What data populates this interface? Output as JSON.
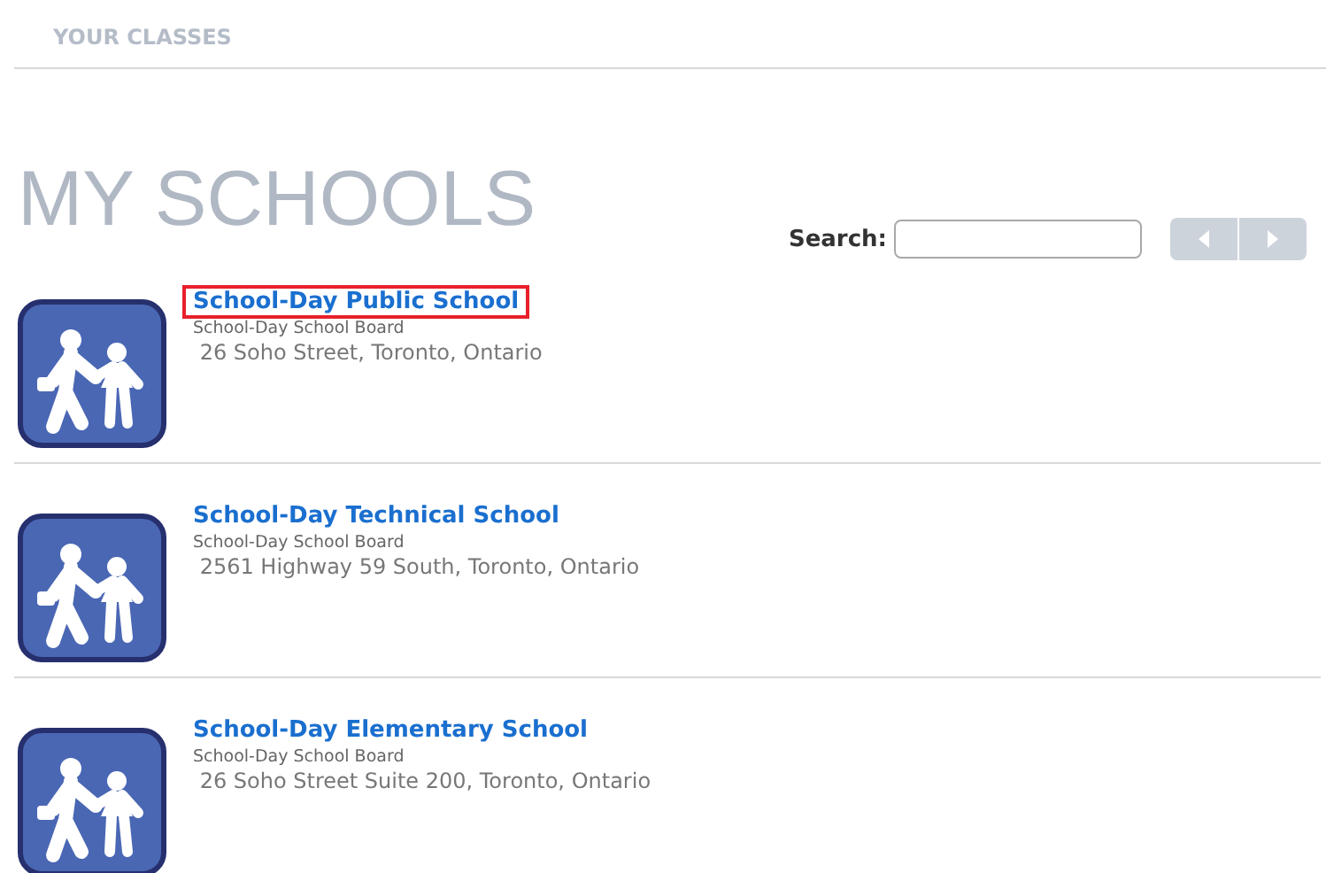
{
  "nav": {
    "label": "YOUR CLASSES"
  },
  "title": "MY SCHOOLS",
  "search": {
    "label": "Search:"
  },
  "pager": {
    "prev_disabled": true,
    "next_disabled": true
  },
  "schools": [
    {
      "name": "School-Day Public School",
      "board": "School-Day School Board",
      "address": " 26 Soho Street, Toronto, Ontario",
      "highlighted": true
    },
    {
      "name": "School-Day Technical School",
      "board": "School-Day School Board",
      "address": " 2561 Highway 59 South, Toronto, Ontario",
      "highlighted": false
    },
    {
      "name": "School-Day Elementary School",
      "board": "School-Day School Board",
      "address": " 26 Soho Street Suite 200, Toronto, Ontario",
      "highlighted": false
    }
  ]
}
